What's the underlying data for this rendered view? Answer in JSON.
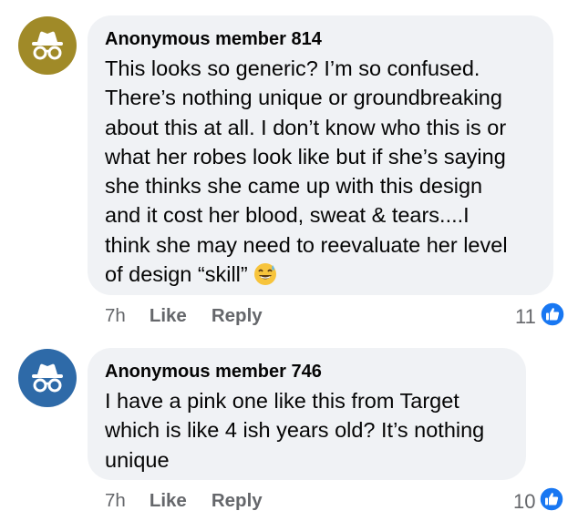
{
  "comments": [
    {
      "author": "Anonymous member 814",
      "avatar_icon": "incognito-hat-glasses-icon",
      "avatar_color": "#a08a28",
      "text_lines": [
        "This looks so generic? I’m so confused.",
        "There’s nothing unique or groundbreaking",
        "about this at all. I don’t know who this is or",
        "what her robes look like but if she’s saying",
        "she thinks she came up with this design",
        "and it cost her blood, sweat & tears....I",
        "think she may need to reevaluate her level",
        "of design “skill”"
      ],
      "emoji": "grinning-sweat-emoji",
      "time": "7h",
      "like_label": "Like",
      "reply_label": "Reply",
      "reaction_count": "11",
      "reaction_icon": "thumbs-up-icon"
    },
    {
      "author": "Anonymous member 746",
      "avatar_icon": "incognito-hat-glasses-icon",
      "avatar_color": "#2e6aa8",
      "text_lines": [
        "I have a pink one like this from Target",
        "which is like 4 ish years old? It’s nothing",
        "unique"
      ],
      "time": "7h",
      "like_label": "Like",
      "reply_label": "Reply",
      "reaction_count": "10",
      "reaction_icon": "thumbs-up-icon"
    }
  ],
  "colors": {
    "bubble": "#f0f2f5",
    "meta_text": "#65676b",
    "like_blue": "#1877f2"
  }
}
